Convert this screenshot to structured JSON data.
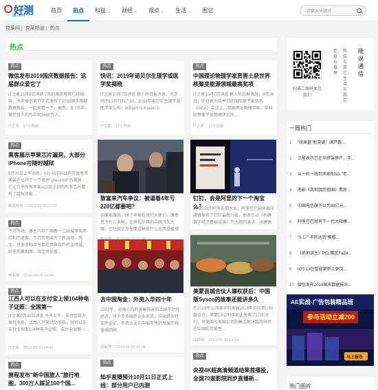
{
  "logo": {
    "main": "好测",
    "sub": "ijii.com"
  },
  "nav": [
    {
      "label": "首页"
    },
    {
      "label": "热点",
      "active": true
    },
    {
      "label": "科技",
      "caret": "⌄"
    },
    {
      "label": "财经",
      "caret": "⌄"
    },
    {
      "label": "观点",
      "caret": "⌄"
    },
    {
      "label": "生活",
      "caret": "⌄"
    },
    {
      "label": "图记"
    }
  ],
  "search": {
    "placeholder": "请输入关键词"
  },
  "breadcrumb": [
    "克莱网",
    "克莱频道",
    "热点"
  ],
  "section_title": "热点",
  "cards": [
    {
      "tag": "热点",
      "title": "微信发布2019国庆数据报告：这届群众爱它了",
      "desc": "IT之家10月8日消息 7天的国庆假期已经结束，今天微信官方正式发布了2019国庆假期数据报告，一起来看一下。据悉，在7天中，微信日人均作中和3480万人...",
      "meta": [
        "IT之家",
        "17小时前"
      ]
    },
    {
      "tag": "热点",
      "title": "快讯：2019年诺贝尔生理学或医学奖揭晓",
      "desc": "IT之家10月7日消息 据人民日报消息，北京时间10月7日17:30，2019年诺贝尔生理学或医学奖公布：William G.Kaelin Jr.",
      "meta": [
        "IT之家",
        "17小时前"
      ]
    },
    {
      "tag": "热点",
      "title": "中国理论物理学家贾晋土获世界核聚变能源领域最高奖项",
      "desc": "IT之家10月7日消息 据人民日报消息，9月26日，在日本大阪举行的国际原子能机构（IAEA）会议上，我国理论物理学家、中科院等离子体物理研究所...",
      "meta": [
        "IT之家",
        "17小时前"
      ]
    },
    {
      "tag": "热点",
      "title": "黑客展示苹果芯片漏洞，大部分iPhone可随时越狱",
      "desc": "9月30日上午消息，IOs A5到A11的开发者黑客最近公开了一个名为\"checkm8\"的漏洞，它让几乎所有苹果A11及之前的所有芯片都有了越狱可能...",
      "meta": [
        "新浪科技",
        "2019-09-30 17:42"
      ]
    },
    {
      "tag": "",
      "title": "致富来汽车争议：被逼着4年亏220亿都要吧？",
      "desc": "如果能赚钱，除了早期投资的大佬们，赚意意于什么来呢，在央视节目的中国汽车大咖，它已就它车里面这种有什么东西是值得一种进去呢？",
      "meta": [
        "电商报",
        "2019-09-30 16:04"
      ]
    },
    {
      "tag": "",
      "title": "钉钉，会是阿里的下一个淘宝么？",
      "desc": "9月25日的阿里云栖大会，阿里巴巴副总裁张建锋发布了钉钉最新升级，他表示以《构建数字经济基础设施》为主题的演讲，张建锋表示钉钉已实现...",
      "meta": [
        "钛媒体",
        "2019-09-30 16:04"
      ]
    },
    {
      "tag": "热点",
      "title": "",
      "desc": "下沉市场：康主内存？随着一二线城市电商红利的退散，下沉市场成为了新战场，淘宝、拼多多和京东都在用各自的打法攻城，阿里的聚划算、淘宝特价版...",
      "meta": [
        "电商报",
        "2019-09-30 16:04"
      ]
    },
    {
      "tag": "",
      "title": "去中国淘金：外资入华四十年",
      "desc": "2002年，中国人均的发展前景的上线不对外经济，对于许多国外企业来说，中国是实打实的金矿，外资企业在中国市场的发展历程值得回顾...",
      "meta": [
        "智能界",
        "2019-09-30 16:04"
      ]
    },
    {
      "tag": "热点",
      "title": "美蒙县城合伙人嫌权获后：中国版Sysco的故事还能讲多久",
      "desc": "在2018年11月美华的发展2019年的应用G50融合之，美蒙CEO刘伟对此发表了1000分刊，有美国与美国公司的模式解决我的市场在中国的可能性...",
      "meta": [
        "红财网",
        "2019-09-30 16:04"
      ]
    },
    {
      "tag": "热点",
      "title": "江西人可以在支付宝上领104种电子证照：全国第一",
      "desc": "IT之家9月30日消息 今天上午，支付宝官方发布消息，江西人只需动动手指，就可以在支付宝领取104种电子证照，成为全国第一...",
      "meta": [
        "IT之家",
        "2019-09-30 14:24"
      ]
    },
    {
      "tag": "热点",
      "title": "携程发布\"新中国旅人\"旅行地图，300万人踩足100个国...",
      "desc": "",
      "meta": []
    },
    {
      "tag": "热点",
      "title": "知乎直播预计10月11日正式上线：部分用户已内测",
      "desc": "",
      "meta": []
    },
    {
      "tag": "热点",
      "title": "央视4K超高清频道结果首播投，全国70家影院同步直播新...",
      "desc": "",
      "meta": []
    }
  ],
  "qr": {
    "label": "扫描二维码关注我们",
    "cols": [
      "晓",
      "说",
      "通",
      "信"
    ],
    "col2": "科技与其它，生活与其它",
    "col3": "信息与推荐"
  },
  "week": {
    "title": "一周热门",
    "items": [
      {
        "num": "1",
        "text": "\"续高盘\"新突破！国产数..."
      },
      {
        "num": "2",
        "text": "三星表示已在华终端停产，手..."
      },
      {
        "num": "3",
        "text": "从一杆一线到天地你5G \"老..."
      },
      {
        "num": "4",
        "text": "电影《我和我的祖国》票房..."
      },
      {
        "num": "5",
        "text": "中国电信旗下公司48亿元..."
      },
      {
        "num": "6",
        "text": "阿里巴巴就有下一代大规模..."
      },
      {
        "num": "7",
        "text": "\"5.17\" 市民达到\"帷幄..."
      },
      {
        "num": "8",
        "text": "《绝地求生》PEL赛区FaZe..."
      },
      {
        "num": "9",
        "text": "IOS 13在智能更新上更加..."
      },
      {
        "num": "10",
        "text": "微信发布2019国庆数据报告..."
      }
    ]
  },
  "ad": {
    "line1": "AE实战·广告包装精品班",
    "line2": "参与活动立减200",
    "line3": "马上报名"
  },
  "pics": {
    "title": "热门图片"
  },
  "colors": {
    "brand": "#1565c0",
    "section": "#4caf50",
    "tag": "#777777"
  }
}
